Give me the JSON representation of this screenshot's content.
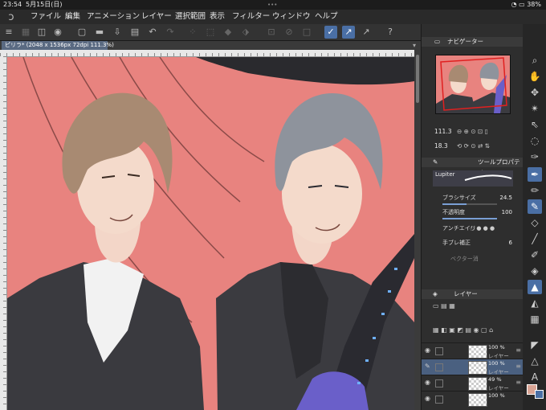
{
  "status": {
    "time": "23:54",
    "date": "5月15日(日)",
    "dots": "•••",
    "battery": "38%"
  },
  "menu": [
    "ファイル",
    "編集",
    "アニメーション",
    "レイヤー",
    "選択範囲",
    "表示",
    "フィルター",
    "ウィンドウ",
    "ヘルプ"
  ],
  "document_tab": "ピリラ* (2048 x 1536px 72dpi 111.3%)",
  "navigator": {
    "title": "ナビゲーター",
    "zoom": "111.3",
    "angle": "18.3"
  },
  "tool_property": {
    "title": "ツールプロパティ",
    "brush_name": "Lupiter",
    "brush_size_label": "ブラシサイズ",
    "brush_size": "24.5",
    "opacity_label": "不透明度",
    "opacity": "100",
    "antialias_label": "アンチエイリ",
    "stabilizer_label": "手ブレ補正",
    "stabilizer": "6",
    "vector_label": "ベクター消"
  },
  "layers": {
    "title": "レイヤー",
    "items": [
      {
        "pct": "100 %",
        "name": "レイヤー"
      },
      {
        "pct": "100 %",
        "name": "レイヤー"
      },
      {
        "pct": "49 %",
        "name": "レイヤー"
      },
      {
        "pct": "100 %",
        "name": ""
      }
    ]
  },
  "colors": {
    "accent": "#4a6fa5",
    "canvas_bg": "#e8837f",
    "main_color": "#d9a494"
  }
}
